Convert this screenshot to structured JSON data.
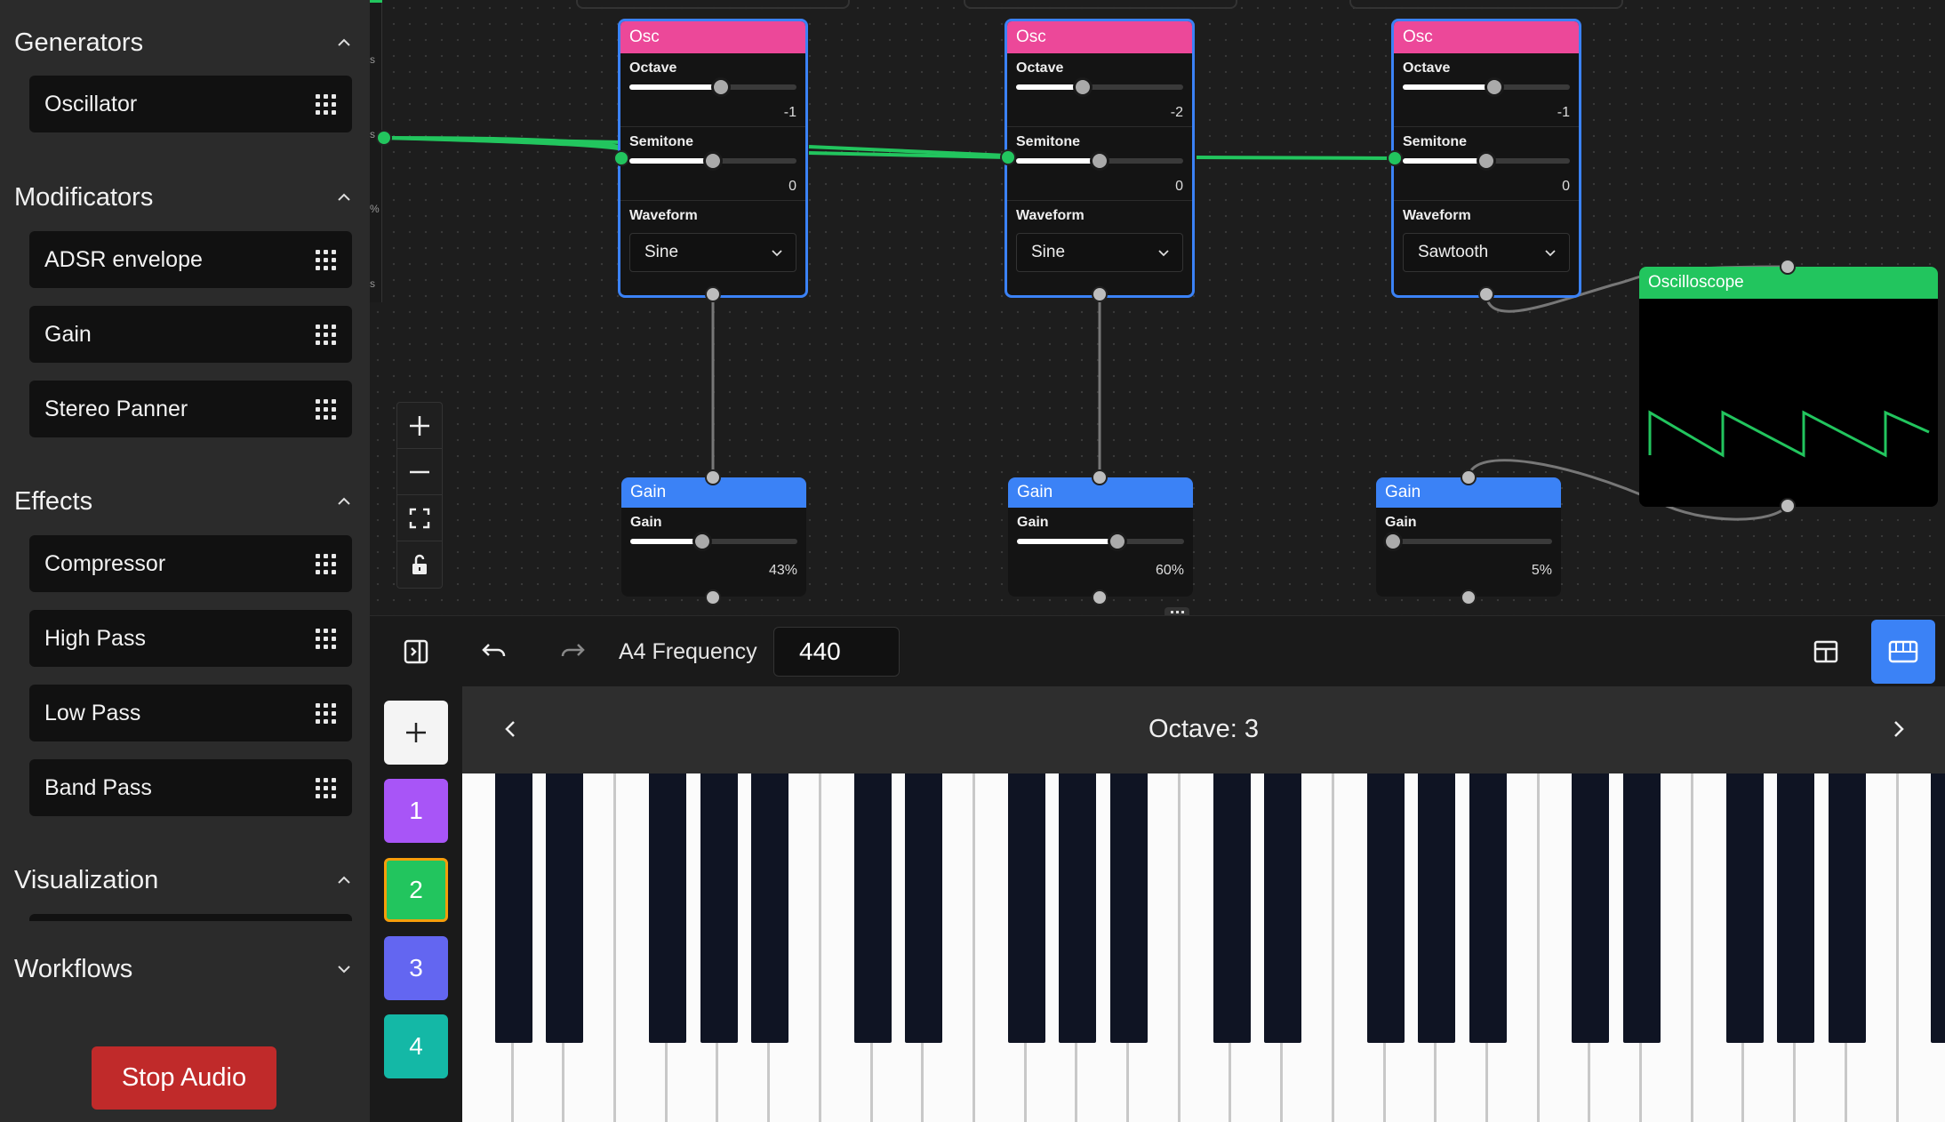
{
  "sidebar": {
    "sections": [
      {
        "title": "Generators",
        "expanded": true,
        "items": [
          "Oscillator"
        ]
      },
      {
        "title": "Modificators",
        "expanded": true,
        "items": [
          "ADSR envelope",
          "Gain",
          "Stereo Panner"
        ]
      },
      {
        "title": "Effects",
        "expanded": true,
        "items": [
          "Compressor",
          "High Pass",
          "Low Pass",
          "Band Pass"
        ]
      },
      {
        "title": "Visualization",
        "expanded": true,
        "items": []
      },
      {
        "title": "Workflows",
        "expanded": false,
        "items": []
      }
    ],
    "stop_label": "Stop Audio"
  },
  "canvas": {
    "stub_letters": [
      "s",
      "s",
      "s",
      "%",
      "s"
    ],
    "oscillators": [
      {
        "title": "Osc",
        "octave_label": "Octave",
        "octave": "-1",
        "octave_pct": 0.55,
        "semitone_label": "Semitone",
        "semitone": "0",
        "semitone_pct": 0.5,
        "waveform_label": "Waveform",
        "waveform": "Sine"
      },
      {
        "title": "Osc",
        "octave_label": "Octave",
        "octave": "-2",
        "octave_pct": 0.4,
        "semitone_label": "Semitone",
        "semitone": "0",
        "semitone_pct": 0.5,
        "waveform_label": "Waveform",
        "waveform": "Sine"
      },
      {
        "title": "Osc",
        "octave_label": "Octave",
        "octave": "-1",
        "octave_pct": 0.55,
        "semitone_label": "Semitone",
        "semitone": "0",
        "semitone_pct": 0.5,
        "waveform_label": "Waveform",
        "waveform": "Sawtooth"
      }
    ],
    "gains": [
      {
        "title": "Gain",
        "label": "Gain",
        "value": "43%",
        "pct": 0.43
      },
      {
        "title": "Gain",
        "label": "Gain",
        "value": "60%",
        "pct": 0.6
      },
      {
        "title": "Gain",
        "label": "Gain",
        "value": "5%",
        "pct": 0.05
      }
    ],
    "scope_title": "Oscilloscope",
    "accent": "#3b82f6",
    "osc_color": "#ec4899",
    "signal_color": "#22c55e"
  },
  "toolbar": {
    "freq_label": "A4 Frequency",
    "freq_value": "440"
  },
  "presets": [
    {
      "label": "1",
      "color": "#a855f7",
      "active": false
    },
    {
      "label": "2",
      "color": "#22c55e",
      "active": true
    },
    {
      "label": "3",
      "color": "#6366f1",
      "active": false
    },
    {
      "label": "4",
      "color": "#14b8a6",
      "active": false
    }
  ],
  "piano": {
    "octave_text": "Octave: 3"
  }
}
